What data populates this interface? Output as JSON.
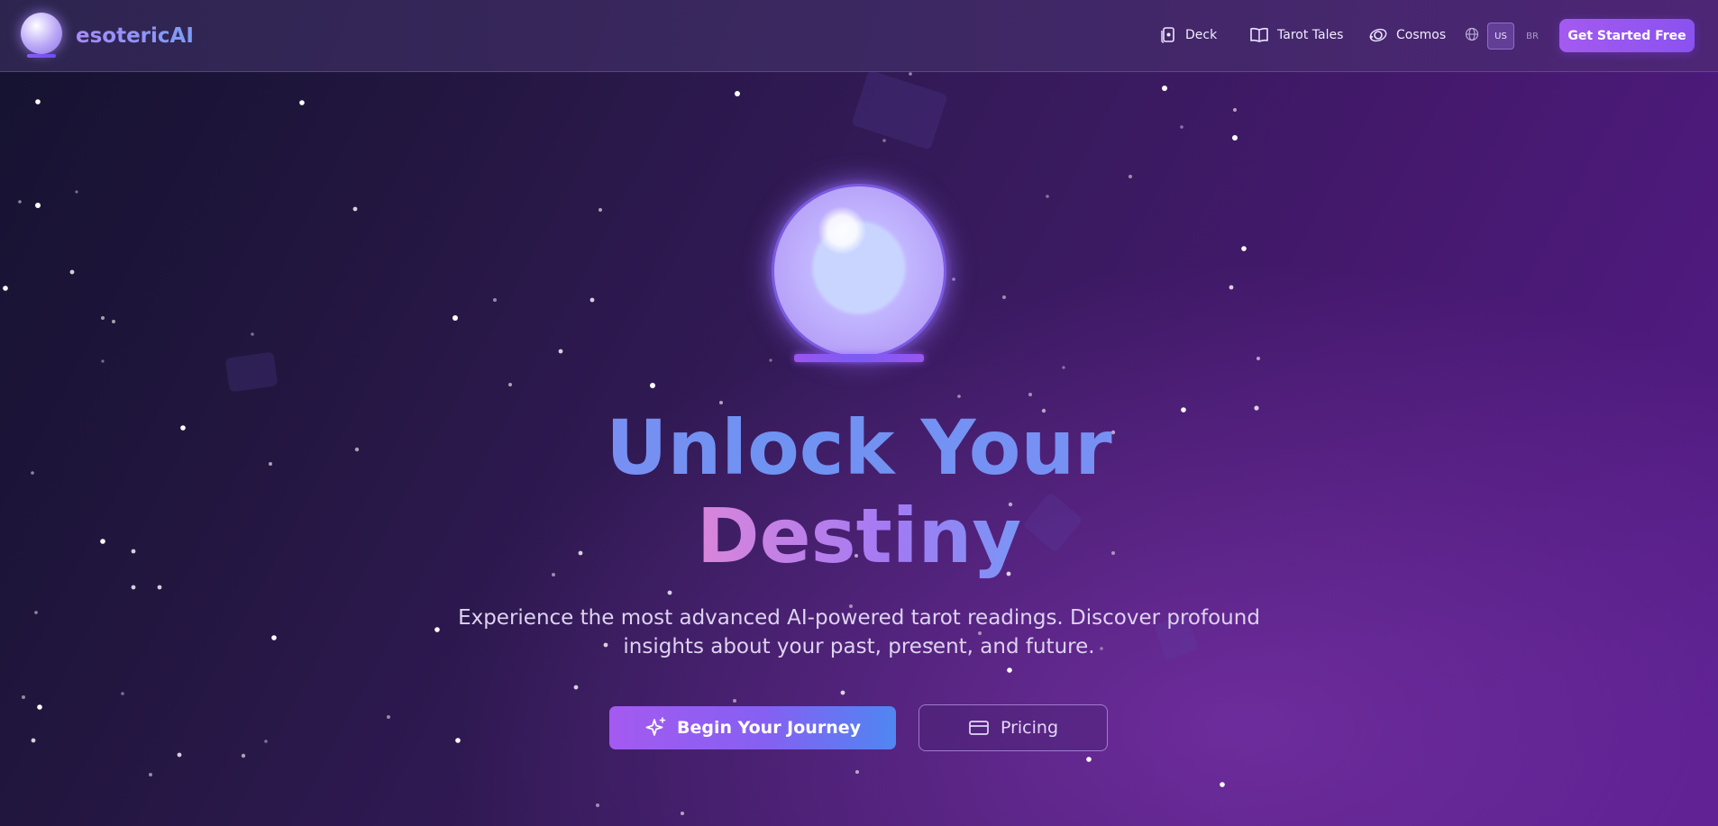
{
  "brand": {
    "name": "esotericAI",
    "logo_icon": "crystal-ball-icon"
  },
  "nav": {
    "items": [
      {
        "label": "Deck",
        "icon": "card-deck-icon"
      },
      {
        "label": "Tarot Tales",
        "icon": "book-icon"
      },
      {
        "label": "Cosmos",
        "icon": "orbit-icon"
      }
    ],
    "language_icon": "globe-icon",
    "languages": [
      {
        "code": "US",
        "active": true
      },
      {
        "code": "BR",
        "active": false
      }
    ],
    "cta_label": "Get Started Free"
  },
  "hero": {
    "title_line1": "Unlock Your",
    "title_line2": "Destiny",
    "subtitle": "Experience the most advanced AI-powered tarot readings. Discover profound insights about your past, present, and future.",
    "primary_button": {
      "label": "Begin Your Journey",
      "icon": "sparkles-icon"
    },
    "secondary_button": {
      "label": "Pricing",
      "icon": "credit-card-icon"
    }
  },
  "colors": {
    "accent_purple": "#a45af0",
    "accent_blue": "#4f86f2",
    "title_pink": "#f08ad0",
    "background_dark": "#151230",
    "background_purple": "#561c8a"
  }
}
